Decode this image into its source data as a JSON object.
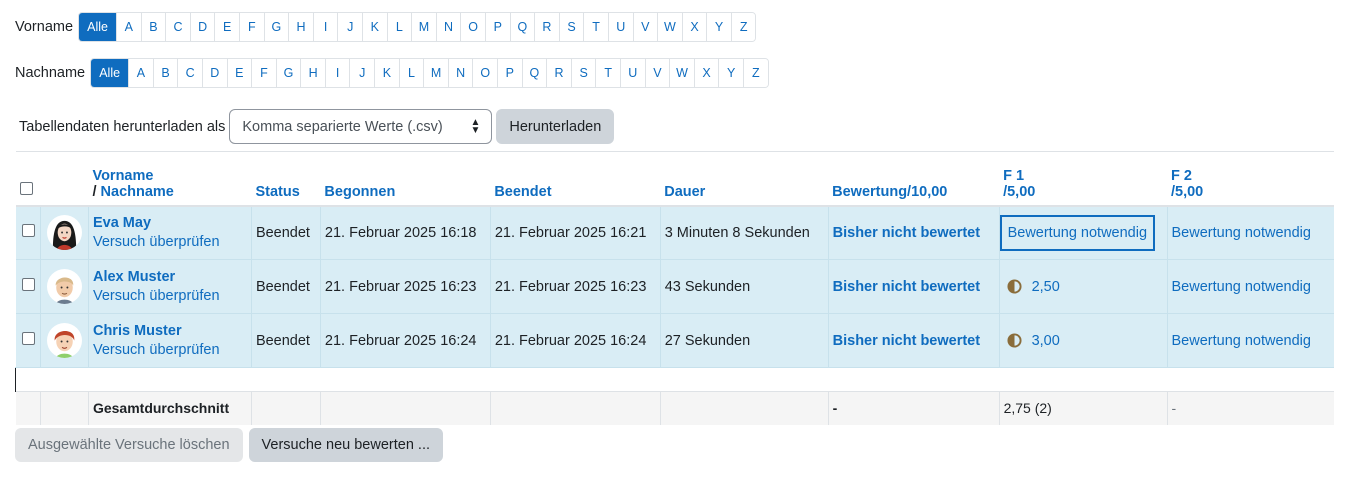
{
  "filters": {
    "firstname_label": "Vorname",
    "lastname_label": "Nachname",
    "all_label": "Alle",
    "letters": [
      "A",
      "B",
      "C",
      "D",
      "E",
      "F",
      "G",
      "H",
      "I",
      "J",
      "K",
      "L",
      "M",
      "N",
      "O",
      "P",
      "Q",
      "R",
      "S",
      "T",
      "U",
      "V",
      "W",
      "X",
      "Y",
      "Z"
    ]
  },
  "download": {
    "label": "Tabellendaten herunterladen als",
    "format": "Komma separierte Werte (.csv)",
    "button": "Herunterladen"
  },
  "table": {
    "headers": {
      "firstname": "Vorname",
      "slash": "/ ",
      "lastname": "Nachname",
      "status": "Status",
      "started": "Begonnen",
      "finished": "Beendet",
      "duration": "Dauer",
      "grade": "Bewertung/10,00",
      "q1_title": "F 1",
      "q1_max": "/5,00",
      "q2_title": "F 2",
      "q2_max": "/5,00"
    },
    "rows": [
      {
        "name": "Eva May",
        "review": "Versuch überprüfen",
        "status": "Beendet",
        "started": "21. Februar 2025 16:18",
        "finished": "21. Februar 2025 16:21",
        "duration": "3 Minuten 8 Sekunden",
        "grade": "Bisher nicht bewertet",
        "q1": "Bewertung notwendig",
        "q2": "Bewertung notwendig"
      },
      {
        "name": "Alex Muster",
        "review": "Versuch überprüfen",
        "status": "Beendet",
        "started": "21. Februar 2025 16:23",
        "finished": "21. Februar 2025 16:23",
        "duration": "43 Sekunden",
        "grade": "Bisher nicht bewertet",
        "q1": "2,50",
        "q2": "Bewertung notwendig"
      },
      {
        "name": "Chris Muster",
        "review": "Versuch überprüfen",
        "status": "Beendet",
        "started": "21. Februar 2025 16:24",
        "finished": "21. Februar 2025 16:24",
        "duration": "27 Sekunden",
        "grade": "Bisher nicht bewertet",
        "q1": "3,00",
        "q2": "Bewertung notwendig"
      }
    ],
    "average": {
      "label": "Gesamtdurchschnitt",
      "grade": "-",
      "q1": "2,75 (2)",
      "q2": "-"
    }
  },
  "actions": {
    "delete": "Ausgewählte Versuche löschen",
    "regrade": "Versuche neu bewerten ..."
  },
  "colors": {
    "accent": "#0f6cbf",
    "row_highlight": "#d9edf5",
    "partial_icon": "#8a6d3b"
  }
}
